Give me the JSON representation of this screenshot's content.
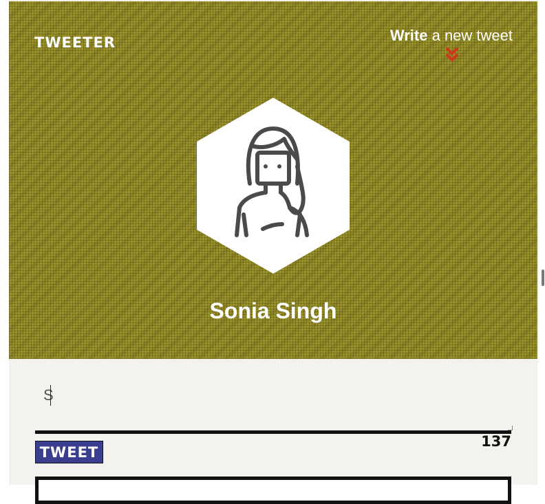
{
  "header": {
    "logo": "TWEETER",
    "write_bold": "Write",
    "write_rest": " a new tweet",
    "chevron_icon": "double-chevron-down-icon",
    "chevron_color": "#d0361c",
    "background_color": "#9a922c"
  },
  "profile": {
    "avatar_icon": "woman-avatar-icon",
    "name": "Sonia Singh"
  },
  "composer": {
    "value": "S",
    "counter": "137",
    "button_label": "TWEET",
    "button_color": "#3b3d8f"
  }
}
